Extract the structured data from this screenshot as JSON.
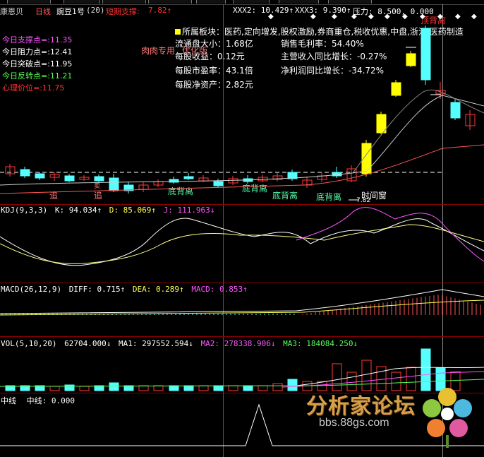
{
  "header": {
    "stock_short": "康恩贝",
    "period": "日线",
    "stock_name": "豌豆1号",
    "param": "(20)",
    "short_support_label": "短期支撑:",
    "short_support_value": "7.82↑",
    "xxx2": "XXX2: 10.429↑",
    "xxx3": "XXX3: 9.390↑",
    "pressure": "压力: 8.500, 0.000"
  },
  "levels": [
    {
      "label": "今日支撑点=:",
      "value": "11.35",
      "color": "#ff55ff"
    },
    {
      "label": "今日阻力点=:",
      "value": "12.41",
      "color": "#ffffff"
    },
    {
      "label": "今日突破点=:",
      "value": "11.95",
      "color": "#ffffff"
    },
    {
      "label": "今日反转点=:",
      "value": "11.21",
      "color": "#55ff55"
    },
    {
      "label": "心理价位=:",
      "value": "11.75",
      "color": "#ff3333"
    }
  ],
  "info": {
    "sector": "所属板块：医药,定向增发,股权激励,券商重仓,税收优惠,中盘,浙江,医药制造",
    "float_cap": "流通盘大小：1.68亿",
    "gross_margin": "销售毛利率：54.40%",
    "eps": "每股收益：0.12元",
    "revenue_growth": "主营收入同比增长：-0.27%",
    "pe": "每股市盈率：43.1倍",
    "profit_growth": "净利润同比增长：-34.72%",
    "nav": "每股净资产：2.82元"
  },
  "annotations": {
    "rourou": "肉肉专用",
    "youhua": "优化版",
    "zhui1": "追",
    "zhui2": "追",
    "dbl1": "底背离",
    "dbl2": "底背离",
    "dbl3": "底背离",
    "dbl4": "底背离",
    "time_window": "时间窗",
    "top_div": "顶背离",
    "sell_small": "卖",
    "num_label": "7.82"
  },
  "kdj": {
    "title": "KDJ(9,3,3)",
    "k": "K: 94.034↑",
    "d": "D: 85.069↑",
    "j": "J: 111.963↓"
  },
  "macd": {
    "title": "MACD(26,12,9)",
    "diff": "DIFF: 0.715↑",
    "dea": "DEA: 0.289↑",
    "macd": "MACD: 0.853↑"
  },
  "vol": {
    "title": "VOL(5,10,20)",
    "vol": "62704.000↓",
    "ma1": "MA1: 297552.594↓",
    "ma2": "MA2: 278338.906↓",
    "ma3": "MA3: 184084.250↓"
  },
  "midline": {
    "title": "中线",
    "label": "中线: 0.000"
  },
  "watermark": {
    "brand": "分析家论坛",
    "url": "bbs.88gs.com"
  },
  "colors": {
    "up": "#ff3b3b",
    "down": "#55ffff",
    "yellow": "#ffff00",
    "magenta": "#ff55ff",
    "green": "#55ff55",
    "white": "#ffffff"
  }
}
